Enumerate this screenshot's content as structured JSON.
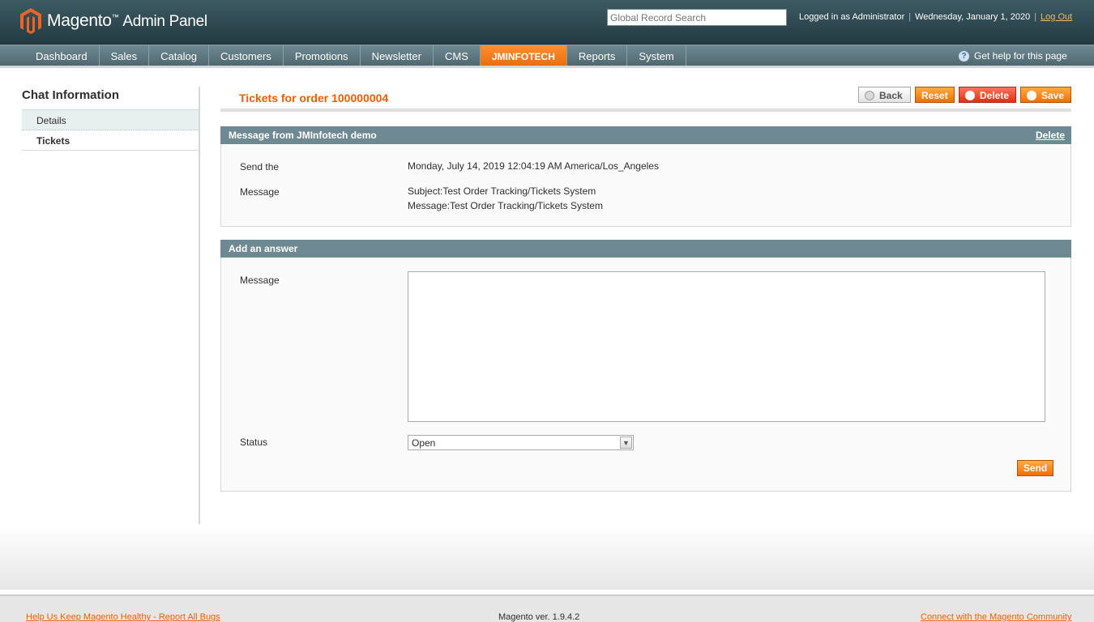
{
  "header": {
    "brand": "Magento",
    "brand_tm": "™",
    "brand_sub": "Admin Panel",
    "search_placeholder": "Global Record Search",
    "logged_in": "Logged in as Administrator",
    "date": "Wednesday, January 1, 2020",
    "logout": "Log Out"
  },
  "nav": {
    "items": [
      "Dashboard",
      "Sales",
      "Catalog",
      "Customers",
      "Promotions",
      "Newsletter",
      "CMS",
      "JMINFOTECH",
      "Reports",
      "System"
    ],
    "active": "JMINFOTECH",
    "help": "Get help for this page"
  },
  "sidebar": {
    "title": "Chat Information",
    "items": [
      "Details",
      "Tickets"
    ]
  },
  "main": {
    "title": "Tickets for order 100000004",
    "buttons": {
      "back": "Back",
      "reset": "Reset",
      "delete": "Delete",
      "save": "Save"
    },
    "message_box": {
      "title": "Message from JMInfotech demo",
      "delete_link": "Delete",
      "send_label": "Send the",
      "send_value": "Monday, July 14, 2019 12:04:19 AM America/Los_Angeles",
      "message_label": "Message",
      "subject_line": "Subject:Test Order Tracking/Tickets System",
      "message_line": "Message:Test Order Tracking/Tickets System"
    },
    "answer_box": {
      "title": "Add an answer",
      "message_label": "Message",
      "message_value": "",
      "status_label": "Status",
      "status_value": "Open",
      "send_button": "Send"
    }
  },
  "footer": {
    "left_link": "Help Us Keep Magento Healthy - Report All Bugs",
    "version": "Magento ver. 1.9.4.2",
    "right_link": "Connect with the Magento Community"
  },
  "colors": {
    "accent": "#eb5e00",
    "header_bg": "#233a42",
    "box_head_bg": "#6f8992"
  }
}
